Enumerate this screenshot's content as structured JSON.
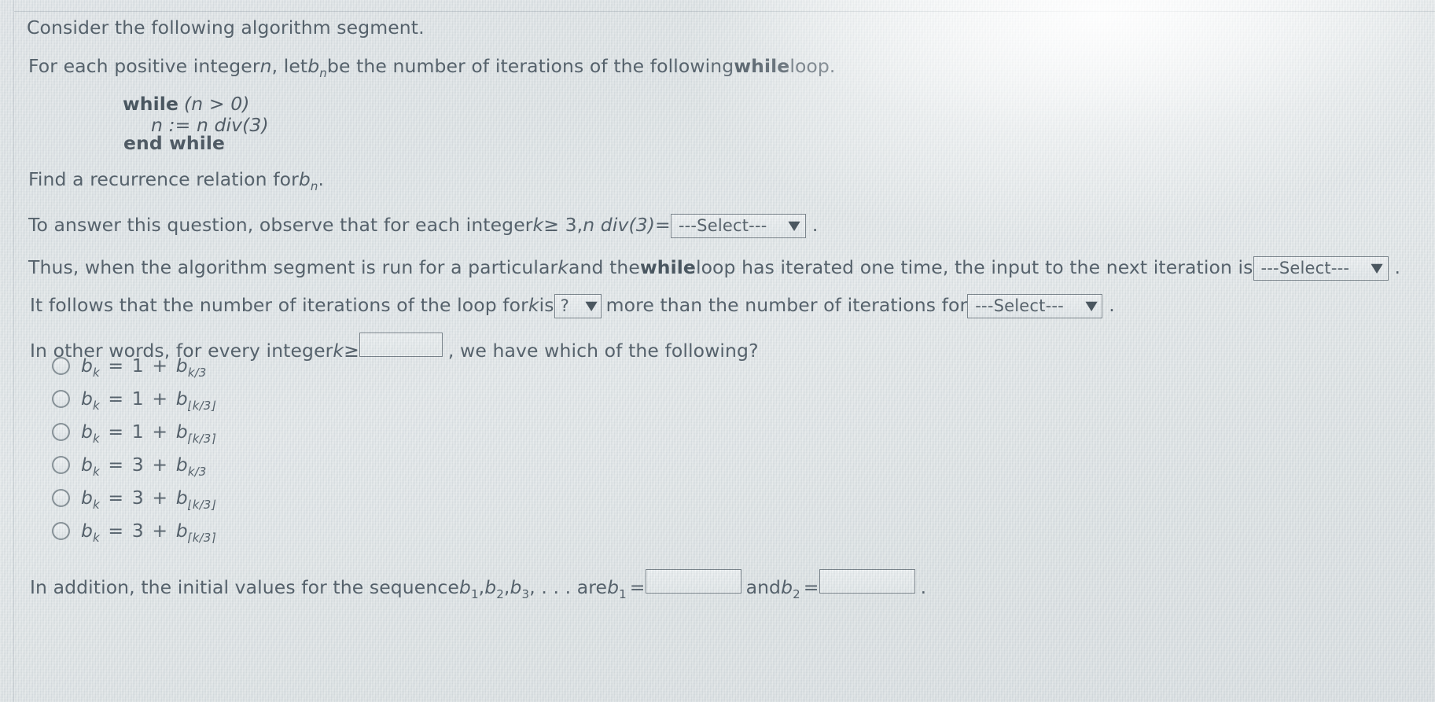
{
  "problem": {
    "intro": "Consider the following algorithm segment.",
    "setup": {
      "pre": "For each positive integer ",
      "var_n": "n",
      "mid": ", let ",
      "var_b": "b",
      "sub_n": "n",
      "post_a": " be the number of iterations of the following ",
      "keyword_while": "while",
      "post_b": " loop."
    },
    "code": {
      "line1_keyword": "while",
      "line1_cond": "(n > 0)",
      "line2": "n := n div(3)",
      "line3": "end while"
    },
    "find": {
      "pre": "Find a recurrence relation for ",
      "var_b": "b",
      "sub_n": "n",
      "post": "."
    },
    "observe": {
      "pre": "To answer this question, observe that for each integer ",
      "var_k": "k",
      "mid": " ≥ 3, ",
      "expr": "n div(3)",
      "equals": " = ",
      "select_value": "---Select---",
      "post": "."
    },
    "thus": {
      "pre": "Thus, when the algorithm segment is run for a particular ",
      "var_k": "k",
      "mid": " and the ",
      "keyword_while": "while",
      "post": " loop has iterated one time, the input to the next iteration is ",
      "select_value": "---Select---",
      "end": "."
    },
    "follows": {
      "pre": "It follows that the number of iterations of the loop for ",
      "var_k": "k",
      "mid": " is ",
      "select_qmark": "?",
      "post": " more than the number of iterations for ",
      "select_value": "---Select---",
      "end": "."
    },
    "inother": {
      "pre": "In other words, for every integer ",
      "var_k": "k",
      "mid": " ≥ ",
      "input_value": "",
      "post": ", we have which of the following?"
    },
    "options": [
      {
        "id": "opt-1",
        "b": "b",
        "sub": "k",
        "eq": " = ",
        "num": "1",
        "plus": " + ",
        "b2": "b",
        "sub2": "k/3"
      },
      {
        "id": "opt-2",
        "b": "b",
        "sub": "k",
        "eq": " = ",
        "num": "1",
        "plus": " + ",
        "b2": "b",
        "sub2": "⌊k/3⌋"
      },
      {
        "id": "opt-3",
        "b": "b",
        "sub": "k",
        "eq": " = ",
        "num": "1",
        "plus": " + ",
        "b2": "b",
        "sub2": "⌈k/3⌉"
      },
      {
        "id": "opt-4",
        "b": "b",
        "sub": "k",
        "eq": " = ",
        "num": "3",
        "plus": " + ",
        "b2": "b",
        "sub2": "k/3"
      },
      {
        "id": "opt-5",
        "b": "b",
        "sub": "k",
        "eq": " = ",
        "num": "3",
        "plus": " + ",
        "b2": "b",
        "sub2": "⌊k/3⌋"
      },
      {
        "id": "opt-6",
        "b": "b",
        "sub": "k",
        "eq": " = ",
        "num": "3",
        "plus": " + ",
        "b2": "b",
        "sub2": "⌈k/3⌉"
      }
    ],
    "initial": {
      "pre": "In addition, the initial values for the sequence ",
      "b1": "b",
      "s1": "1",
      "c1": ", ",
      "b2": "b",
      "s2": "2",
      "c2": ", ",
      "b3": "b",
      "s3": "3",
      "c3": ", . . . are ",
      "bA": "b",
      "sA": "1",
      "eqA": " = ",
      "inputA_value": "",
      "and": " and ",
      "bB": "b",
      "sB": "2",
      "eqB": " = ",
      "inputB_value": "",
      "end": "."
    },
    "icons": {
      "caret": "chevron-down-icon"
    }
  }
}
